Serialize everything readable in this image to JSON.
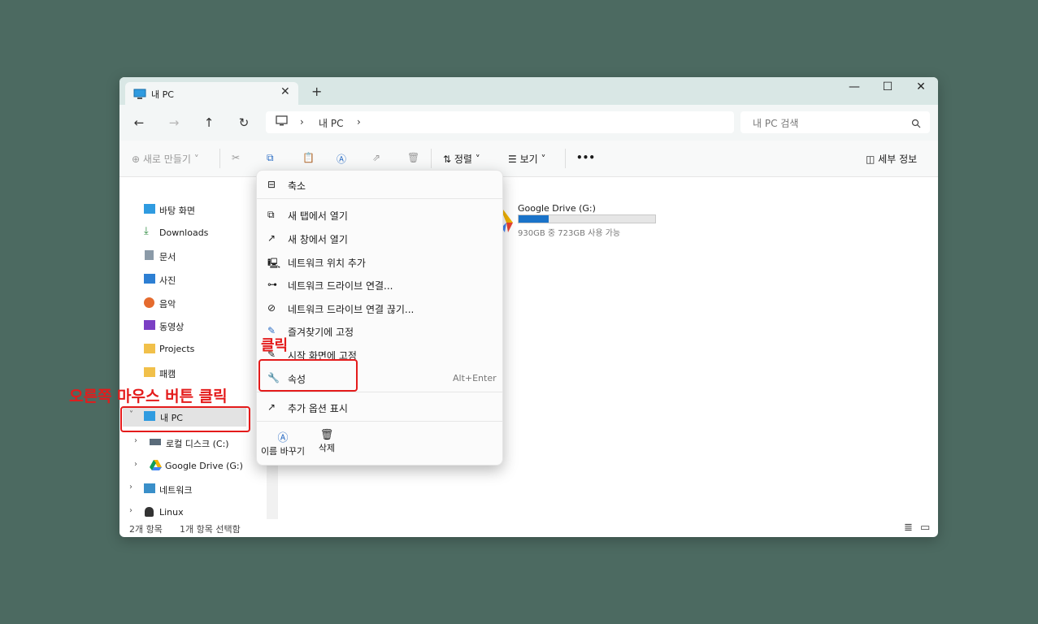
{
  "window": {
    "tab_title": "내 PC",
    "tab_close": "✕",
    "new_tab": "+",
    "minimize": "—",
    "maximize": "☐",
    "close": "✕"
  },
  "nav": {
    "back": "←",
    "forward": "→",
    "up": "↑",
    "refresh": "↻",
    "breadcrumb": [
      "내 PC"
    ],
    "chevron": "›",
    "search_placeholder": "내 PC 검색"
  },
  "toolbar": {
    "new_label": "새로 만들기",
    "sort_label": "정렬",
    "view_label": "보기",
    "more_label": "•••",
    "details_label": "세부 정보"
  },
  "sidebar": {
    "items": [
      {
        "label": "바탕 화면"
      },
      {
        "label": "Downloads"
      },
      {
        "label": "문서"
      },
      {
        "label": "사진"
      },
      {
        "label": "음악"
      },
      {
        "label": "동영상"
      },
      {
        "label": "Projects"
      },
      {
        "label": "패캠"
      },
      {
        "label": "내 PC"
      },
      {
        "label": "로컬 디스크 (C:)"
      },
      {
        "label": "Google Drive (G:)"
      },
      {
        "label": "네트워크"
      },
      {
        "label": "Linux"
      }
    ]
  },
  "drive": {
    "name": "Google Drive (G:)",
    "usage_text": "930GB 중 723GB 사용 가능",
    "used_fraction": 0.22
  },
  "status": {
    "count": "2개 항목",
    "selected": "1개 항목 선택함"
  },
  "context_menu": {
    "collapse": "축소",
    "items": [
      {
        "label": "새 탭에서 열기"
      },
      {
        "label": "새 창에서 열기"
      },
      {
        "label": "네트워크 위치 추가"
      },
      {
        "label": "네트워크 드라이브 연결..."
      },
      {
        "label": "네트워크 드라이브 연결 끊기..."
      },
      {
        "label": "즐겨찾기에 고정"
      },
      {
        "label": "시작 화면에 고정"
      }
    ],
    "properties": "속성",
    "properties_shortcut": "Alt+Enter",
    "more_options": "추가 옵션 표시",
    "rename": "이름 바꾸기",
    "delete": "삭제"
  },
  "annotations": {
    "click": "클릭",
    "right_click": "오른쪽 마우스 버튼 클릭"
  },
  "colors": {
    "background": "#4c6a61",
    "accent": "#1a73c9",
    "annotation": "#e41b1b"
  }
}
